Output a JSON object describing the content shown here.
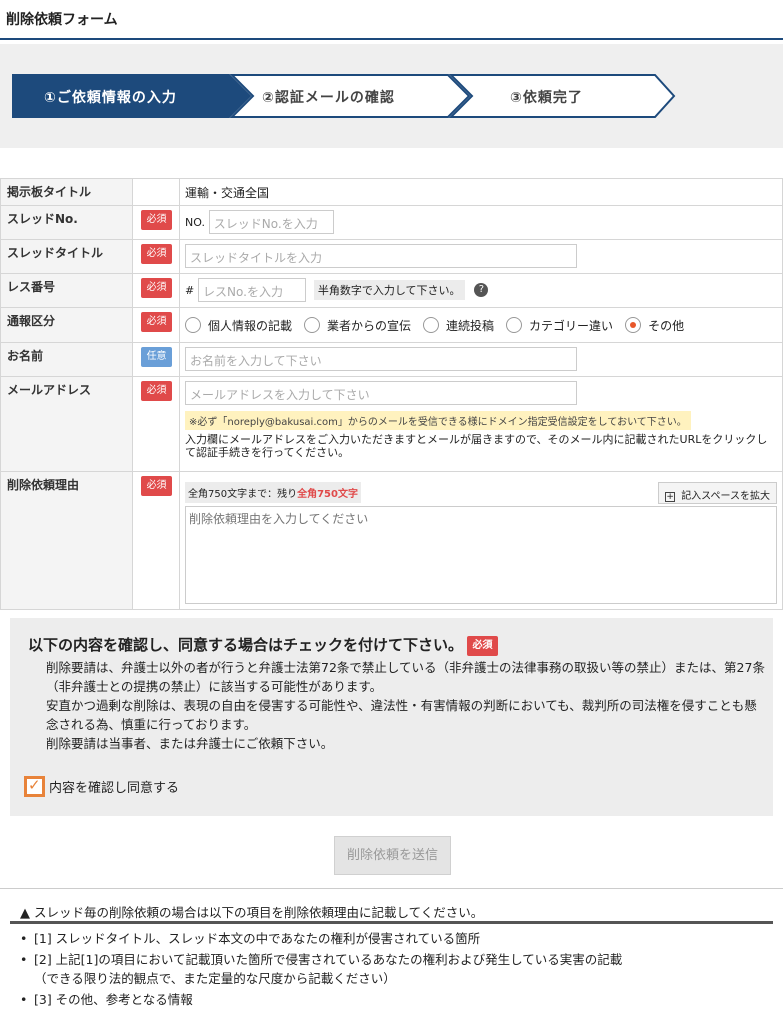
{
  "page": {
    "title": "削除依頼フォーム"
  },
  "steps": [
    {
      "label": "①ご依頼情報の入力",
      "active": true
    },
    {
      "label": "②認証メールの確認",
      "active": false
    },
    {
      "label": "③依頼完了",
      "active": false
    }
  ],
  "colors": {
    "step_active": "#1d4a7c",
    "required": "#e04a4a",
    "optional": "#6a9fd8",
    "accent": "#e8833a"
  },
  "form": {
    "board": {
      "label": "掲示板タイトル",
      "value": "運輸・交通全国"
    },
    "thread_no": {
      "label": "スレッドNo.",
      "badge": "必須",
      "prefix": "NO.",
      "placeholder": "スレッドNo.を入力"
    },
    "thread_title": {
      "label": "スレッドタイトル",
      "badge": "必須",
      "placeholder": "スレッドタイトルを入力"
    },
    "res_no": {
      "label": "レス番号",
      "badge": "必須",
      "prefix": "#",
      "placeholder": "レスNo.を入力",
      "hint": "半角数字で入力して下さい。",
      "help_icon": "question-icon"
    },
    "category": {
      "label": "通報区分",
      "badge": "必須",
      "options": [
        "個人情報の記載",
        "業者からの宣伝",
        "連続投稿",
        "カテゴリー違い",
        "その他"
      ],
      "selected": "その他"
    },
    "name": {
      "label": "お名前",
      "badge": "任意",
      "placeholder": "お名前を入力して下さい"
    },
    "email": {
      "label": "メールアドレス",
      "badge": "必須",
      "placeholder": "メールアドレスを入力して下さい",
      "notice": "※必ず「noreply@bakusai.com」からのメールを受信できる様にドメイン指定受信設定をしておいて下さい。",
      "note": "入力欄にメールアドレスをご入力いただきますとメールが届きますので、そのメール内に記載されたURLをクリックして認証手続きを行ってください。"
    },
    "reason": {
      "label": "削除依頼理由",
      "badge": "必須",
      "counter_prefix": "全角750文字まで：残り",
      "counter_remaining": "全角750文字",
      "expand_label": "記入スペースを拡大",
      "placeholder": "削除依頼理由を入力してください"
    }
  },
  "agreement": {
    "title": "以下の内容を確認し、同意する場合はチェックを付けて下さい。",
    "badge": "必須",
    "paragraphs": [
      "削除要請は、弁護士以外の者が行うと弁護士法第72条で禁止している（非弁護士の法律事務の取扱い等の禁止）または、第27条（非弁護士との提携の禁止）に該当する可能性があります。",
      "安直かつ過剰な削除は、表現の自由を侵害する可能性や、違法性・有害情報の判断においても、裁判所の司法権を侵すことも懸念される為、慎重に行っております。",
      "削除要請は当事者、または弁護士にご依頼下さい。"
    ],
    "checkbox_label": "内容を確認し同意する",
    "checked": true
  },
  "submit": {
    "label": "削除依頼を送信"
  },
  "info": {
    "title": "スレッド毎の削除依頼の場合は以下の項目を削除依頼理由に記載してください。",
    "items": [
      {
        "text": "[1] スレッドタイトル、スレッド本文の中であなたの権利が侵害されている箇所",
        "sub": ""
      },
      {
        "text": "[2] 上記[1]の項目において記載頂いた箇所で侵害されているあなたの権利および発生している実害の記載",
        "sub": "（できる限り法的観点で、また定量的な尺度から記載ください）"
      },
      {
        "text": "[3] その他、参考となる情報",
        "sub": ""
      }
    ]
  }
}
